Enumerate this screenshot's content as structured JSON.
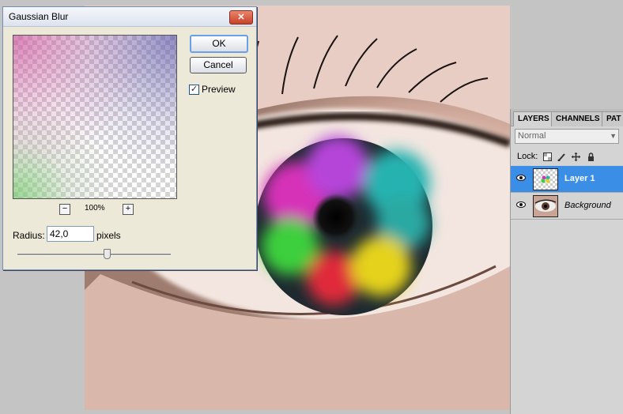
{
  "dialog": {
    "title": "Gaussian Blur",
    "close_label": "✕",
    "ok_label": "OK",
    "cancel_label": "Cancel",
    "preview_label": "Preview",
    "preview_checked": true,
    "zoom_out_label": "−",
    "zoom_in_label": "+",
    "zoom_level": "100%",
    "radius_label": "Radius:",
    "radius_value": "42,0",
    "radius_unit": "pixels"
  },
  "layers_panel": {
    "tabs": [
      "LAYERS",
      "CHANNELS",
      "PAT"
    ],
    "blend_mode": "Normal",
    "lock_label": "Lock:",
    "layers": [
      {
        "name": "Layer 1",
        "selected": true
      },
      {
        "name": "Background",
        "selected": false
      }
    ]
  },
  "colors": {
    "selection": "#3a8ee6",
    "dialog_bg": "#ece9d8",
    "panel_bg": "#d4d4d4"
  }
}
